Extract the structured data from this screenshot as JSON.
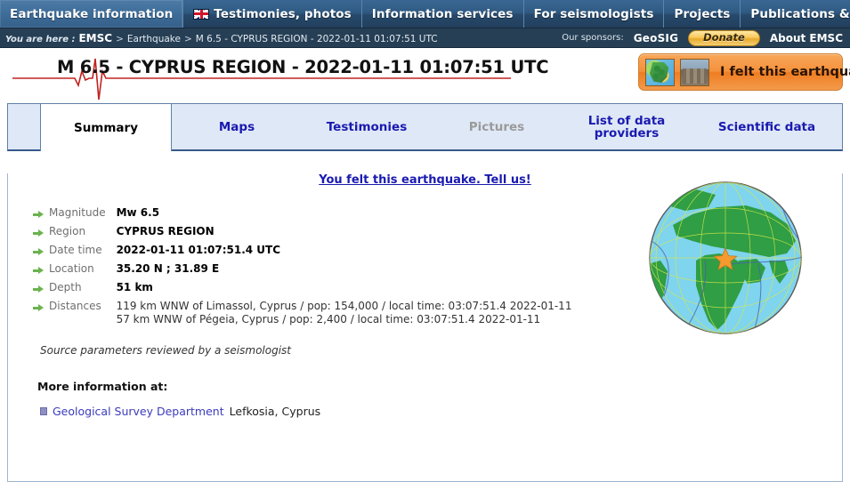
{
  "topnav": {
    "items": [
      {
        "label": "Earthquake information",
        "active": true,
        "icon": null
      },
      {
        "label": "Testimonies, photos",
        "active": false,
        "icon": "uk-flag-icon"
      },
      {
        "label": "Information services",
        "active": false,
        "icon": null
      },
      {
        "label": "For seismologists",
        "active": false,
        "icon": null
      },
      {
        "label": "Projects",
        "active": false,
        "icon": null
      },
      {
        "label": "Publications & docs",
        "active": false,
        "icon": null
      }
    ]
  },
  "breadcrumb": {
    "you_are_here": "You are here :",
    "root": "EMSC",
    "sep": ">",
    "section": "Earthquake",
    "current": "M 6.5 - CYPRUS REGION - 2022-01-11 01:07:51 UTC"
  },
  "sponsors": {
    "label": "Our sponsors:",
    "name": "GeoSIG",
    "donate_label": "Donate",
    "about_label": "About EMSC"
  },
  "header": {
    "title": "M 6.5 - CYPRUS REGION - 2022-01-11 01:07:51 UTC",
    "felt_button_label": "I felt this earthquake"
  },
  "tabs": [
    {
      "label": "Summary",
      "state": "active"
    },
    {
      "label": "Maps",
      "state": "normal"
    },
    {
      "label": "Testimonies",
      "state": "normal"
    },
    {
      "label": "Pictures",
      "state": "disabled"
    },
    {
      "label": "List of data\nproviders",
      "label_line1": "List of data",
      "label_line2": "providers",
      "state": "normal"
    },
    {
      "label": "Scientific data",
      "state": "normal"
    }
  ],
  "main": {
    "felt_link": "You felt this earthquake. Tell us!",
    "parameters": [
      {
        "label": "Magnitude",
        "value": "Mw 6.5"
      },
      {
        "label": "Region",
        "value": "CYPRUS REGION"
      },
      {
        "label": "Date time",
        "value": "2022-01-11 01:07:51.4 UTC"
      },
      {
        "label": "Location",
        "value": "35.20 N ; 31.89 E"
      },
      {
        "label": "Depth",
        "value": "51 km"
      }
    ],
    "distances": {
      "label": "Distances",
      "lines": [
        "119 km WNW of Limassol, Cyprus / pop: 154,000 / local time: 03:07:51.4 2022-01-11",
        "57 km WNW of Pégeia, Cyprus / pop: 2,400 / local time: 03:07:51.4 2022-01-11"
      ]
    },
    "reviewed_note": "Source parameters reviewed by a seismologist",
    "more_info_heading": "More information at:",
    "more_info_link": "Geological Survey Department",
    "more_info_tail": "Lefkosia, Cyprus"
  },
  "colors": {
    "nav_blue": "#2f5a82",
    "crumb_blue": "#263f55",
    "tab_strip": "#dfe8f6",
    "link_blue": "#1a1ab0",
    "accent_orange": "#ef7d21",
    "donate_gold": "#f7c85a",
    "arrow_green": "#6ab24e",
    "seismo_red": "#c0231f",
    "epicenter_star": "#f59a2e"
  }
}
